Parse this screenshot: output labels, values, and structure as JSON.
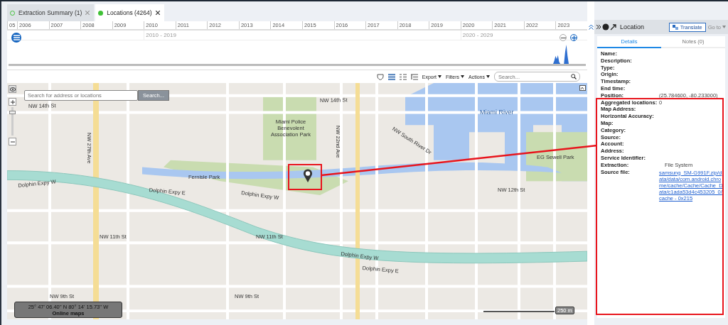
{
  "tabs": [
    {
      "label": "Extraction Summary (1)",
      "selected": false
    },
    {
      "label": "Locations (4264)",
      "selected": true
    }
  ],
  "timeline": {
    "years": [
      "05",
      "2006",
      "2007",
      "2008",
      "2009",
      "2010",
      "2011",
      "2012",
      "2013",
      "2014",
      "2015",
      "2016",
      "2017",
      "2018",
      "2019",
      "2020",
      "2021",
      "2022",
      "2023"
    ],
    "decades": [
      "2010 - 2019",
      "2020 - 2029"
    ]
  },
  "toolbar": {
    "menus": [
      "Export",
      "Filters",
      "Actions"
    ],
    "search": {
      "placeholder": "Search..."
    }
  },
  "map": {
    "search": {
      "placeholder": "Search for address or locations"
    },
    "search_button": "Search...",
    "zoom": {
      "level": 0.85
    },
    "coordinates": "25° 47' 06.40'' N 80° 14' 15.73'' W",
    "source_button": "Online maps",
    "scale": "250 m",
    "labels": [
      "NW 14th St",
      "NW 14th St",
      "Miami River",
      "Dolphin Expy W",
      "Dolphin Expy E",
      "Dolphin Expy W",
      "Fernisle Park",
      "NW 11th St",
      "NW 11th St",
      "Dolphin Expy W",
      "Dolphin Expy E",
      "NW 9th St",
      "NW 9th St",
      "NW 27th Ave",
      "NW 22nd Ave",
      "NW South River Dr",
      "NW 12th St",
      "Miami Police Benevolent Association Park",
      "EG Sewell Park"
    ]
  },
  "panel": {
    "title": "Location",
    "translate": "Translate",
    "goto": {
      "label": "Go to",
      "disabled": true
    },
    "tabs": [
      {
        "label": "Details",
        "selected": true
      },
      {
        "label": "Notes (0)",
        "selected": false
      }
    ],
    "fields": [
      {
        "label": "Name:"
      },
      {
        "label": "Description:"
      },
      {
        "label": "Type:"
      },
      {
        "label": "Origin:"
      },
      {
        "label": "Timestamp:"
      },
      {
        "label": "End time:"
      },
      {
        "label": "Position:",
        "value": "(25.784600, -80.233000)",
        "kind": "text"
      },
      {
        "label": "Aggregated locations:",
        "value": "0",
        "kind": "text"
      },
      {
        "label": "Map Address:"
      },
      {
        "label": "Horizontal Accuracy:"
      },
      {
        "label": "Map:"
      },
      {
        "label": "Category:"
      },
      {
        "label": "Source:"
      },
      {
        "label": "Account:"
      },
      {
        "label": "Address:"
      },
      {
        "label": "Service Identifier:"
      },
      {
        "label": "Extraction:",
        "value": "File System",
        "kind": "text"
      },
      {
        "label": "Source file:",
        "value": "samsung_SM-G991F.zip/data/data/com.android.chrome/cache/Cache/Cache_Data/c1ada53d4c453205_0/cache - 0x215",
        "kind": "link"
      }
    ]
  }
}
